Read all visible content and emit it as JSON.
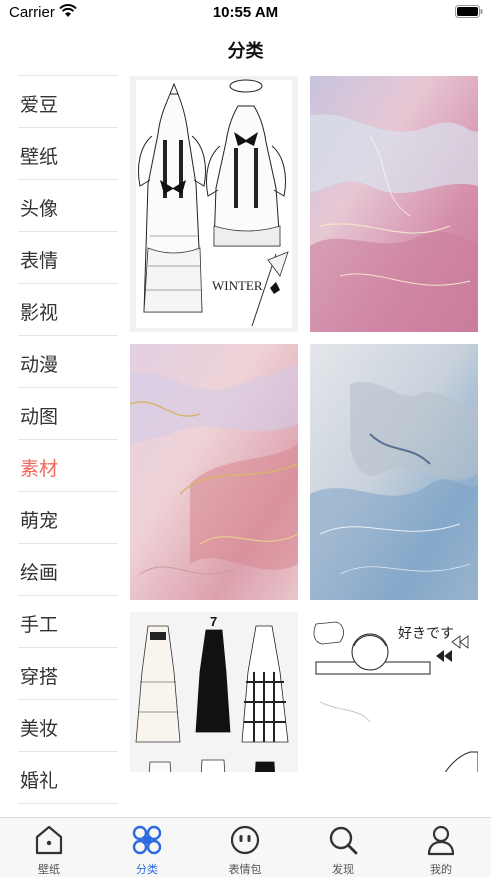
{
  "status_bar": {
    "carrier": "Carrier",
    "time": "10:55 AM"
  },
  "nav": {
    "title": "分类"
  },
  "sidebar": {
    "active_index": 7,
    "items": [
      {
        "label": "爱豆"
      },
      {
        "label": "壁纸"
      },
      {
        "label": "头像"
      },
      {
        "label": "表情"
      },
      {
        "label": "影视"
      },
      {
        "label": "动漫"
      },
      {
        "label": "动图"
      },
      {
        "label": "素材"
      },
      {
        "label": "萌宠"
      },
      {
        "label": "绘画"
      },
      {
        "label": "手工"
      },
      {
        "label": "穿搭"
      },
      {
        "label": "美妆"
      },
      {
        "label": "婚礼"
      }
    ]
  },
  "grid": {
    "tiles": [
      {
        "subject": "lolita-dress-sketch",
        "caption": "WINTER"
      },
      {
        "subject": "pink-marble"
      },
      {
        "subject": "rose-gold-marble"
      },
      {
        "subject": "blue-marble"
      },
      {
        "subject": "dress-sketches",
        "caption": "7"
      },
      {
        "subject": "anime-doodle",
        "caption": "好きです"
      }
    ]
  },
  "tab_bar": {
    "active_index": 1,
    "tabs": [
      {
        "label": "壁纸",
        "icon": "home-icon"
      },
      {
        "label": "分类",
        "icon": "category-icon"
      },
      {
        "label": "表情包",
        "icon": "smiley-icon"
      },
      {
        "label": "发现",
        "icon": "search-icon"
      },
      {
        "label": "我的",
        "icon": "profile-icon"
      }
    ]
  },
  "colors": {
    "active_sidebar": "#f0695a",
    "active_tab": "#2f6be0",
    "inactive_tab": "#555555"
  }
}
